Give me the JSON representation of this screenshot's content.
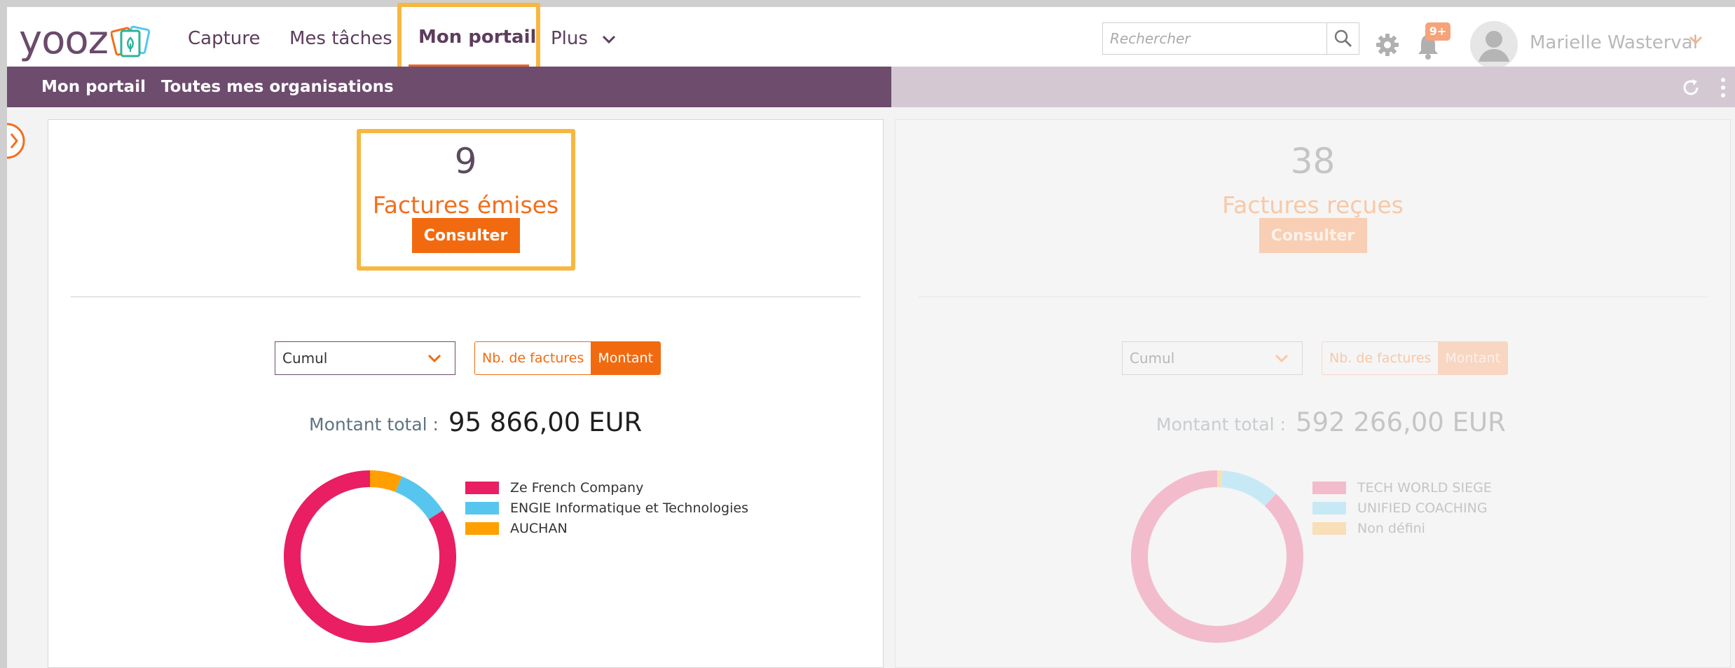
{
  "app": {
    "logo_text": "yooz"
  },
  "nav": {
    "items": [
      {
        "label": "Capture"
      },
      {
        "label": "Mes tâches"
      },
      {
        "label": "Mon portail"
      },
      {
        "label": "Plus"
      }
    ],
    "active": "Mon portail"
  },
  "search": {
    "placeholder": "Rechercher"
  },
  "notifications": {
    "badge": "9+"
  },
  "user": {
    "name": "Marielle Wasterval"
  },
  "subnav": {
    "items": [
      {
        "label": "Mon portail"
      },
      {
        "label": "Toutes mes organisations"
      }
    ]
  },
  "cards": [
    {
      "count": "9",
      "label": "Factures émises",
      "button": "Consulter",
      "select_value": "Cumul",
      "toggle": {
        "option1": "Nb. de factures",
        "option2": "Montant",
        "selected": "Montant"
      },
      "total_label": "Montant total :",
      "total_value": "95 866,00 EUR",
      "legend": [
        {
          "name": "Ze French Company",
          "color": "#e91e63"
        },
        {
          "name": "ENGIE Informatique et Technologies",
          "color": "#56c6ee"
        },
        {
          "name": "AUCHAN",
          "color": "#ffa000"
        }
      ]
    },
    {
      "count": "38",
      "label": "Factures reçues",
      "button": "Consulter",
      "select_value": "Cumul",
      "toggle": {
        "option1": "Nb. de factures",
        "option2": "Montant",
        "selected": "Montant"
      },
      "total_label": "Montant total :",
      "total_value": "592 266,00 EUR",
      "legend": [
        {
          "name": "TECH WORLD SIEGE",
          "color": "#f2bccd"
        },
        {
          "name": "UNIFIED COACHING",
          "color": "#c7e9f6"
        },
        {
          "name": "Non défini",
          "color": "#f8dfb8"
        }
      ]
    }
  ],
  "chart_data": [
    {
      "type": "pie",
      "categories": [
        "Ze French Company",
        "ENGIE Informatique et Technologies",
        "AUCHAN"
      ],
      "values": [
        84,
        10,
        6
      ],
      "colors": [
        "#e91e63",
        "#56c6ee",
        "#ffa000"
      ]
    },
    {
      "type": "pie",
      "categories": [
        "TECH WORLD SIEGE",
        "UNIFIED COACHING",
        "Non défini"
      ],
      "values": [
        88,
        11,
        1
      ],
      "colors": [
        "#f2bccd",
        "#c7e9f6",
        "#f8dfb8"
      ]
    }
  ]
}
